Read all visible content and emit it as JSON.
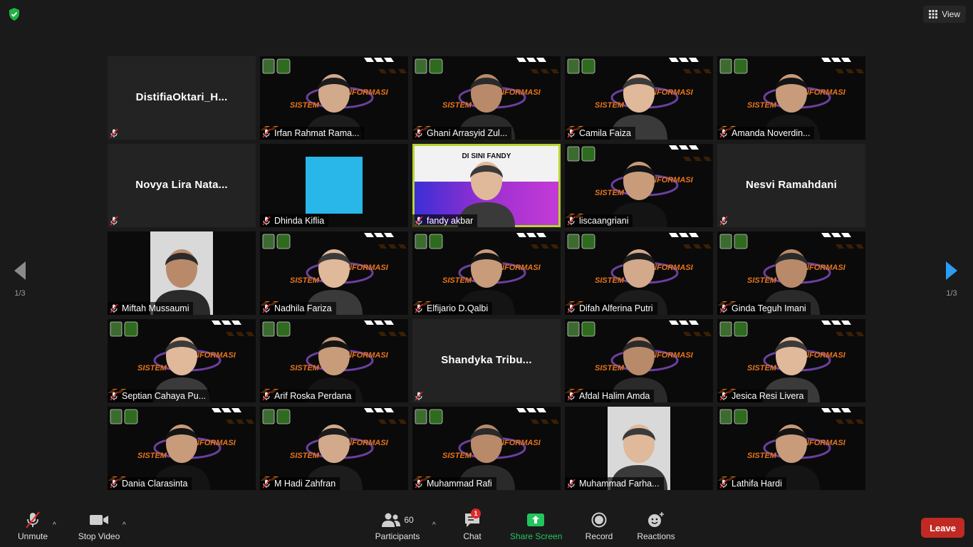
{
  "top": {
    "view_label": "View"
  },
  "pager": {
    "page_left": "1/3",
    "page_right": "1/3"
  },
  "tiles": [
    {
      "name": "DistifiaOktari_H...",
      "label": "",
      "video": false
    },
    {
      "name": "Irfan Rahmat Rama...",
      "video": true
    },
    {
      "name": "Ghani Arrasyid Zul...",
      "video": true
    },
    {
      "name": "Camila Faiza",
      "video": true
    },
    {
      "name": "Amanda Noverdin...",
      "video": true
    },
    {
      "name": "Novya  Lira  Nata...",
      "label": "",
      "video": false
    },
    {
      "name": "Dhinda Kiflia",
      "video": true
    },
    {
      "name": "fandy akbar",
      "video": true,
      "speaker": true,
      "overlay_text": "DI SINI FANDY"
    },
    {
      "name": "liscaangriani",
      "video": true
    },
    {
      "name": "Nesvi Ramahdani",
      "label": "",
      "video": false
    },
    {
      "name": "Miftah Mussaumi",
      "video": true
    },
    {
      "name": "Nadhila Fariza",
      "video": true
    },
    {
      "name": "Elfijario D.Qalbi",
      "video": true
    },
    {
      "name": "Difah Alferina Putri",
      "video": true
    },
    {
      "name": "Ginda Teguh Imani",
      "video": true
    },
    {
      "name": "Septian Cahaya Pu...",
      "video": true
    },
    {
      "name": "Arif Roska Perdana",
      "video": true
    },
    {
      "name": "Shandyka  Tribu...",
      "label": "",
      "video": false
    },
    {
      "name": "Afdal Halim Amda",
      "video": true
    },
    {
      "name": "Jesica Resi Livera",
      "video": true
    },
    {
      "name": "Dania Clarasinta",
      "video": true
    },
    {
      "name": "M Hadi Zahfran",
      "video": true
    },
    {
      "name": "Muhammad Rafi",
      "video": true
    },
    {
      "name": "Muhammad Farha...",
      "video": true
    },
    {
      "name": "Lathifa Hardi",
      "video": true
    }
  ],
  "banner_text": {
    "left": "SISTEM",
    "right": "INFORMASI"
  },
  "toolbar": {
    "unmute": "Unmute",
    "stop_video": "Stop Video",
    "participants": "Participants",
    "participants_count": "60",
    "chat": "Chat",
    "chat_badge": "1",
    "share_screen": "Share Screen",
    "record": "Record",
    "reactions": "Reactions",
    "leave": "Leave"
  },
  "colors": {
    "accent_green": "#22c55e",
    "leave_red": "#c02a23",
    "speaker_border": "#b8d431",
    "background": "#1a1a1a"
  }
}
